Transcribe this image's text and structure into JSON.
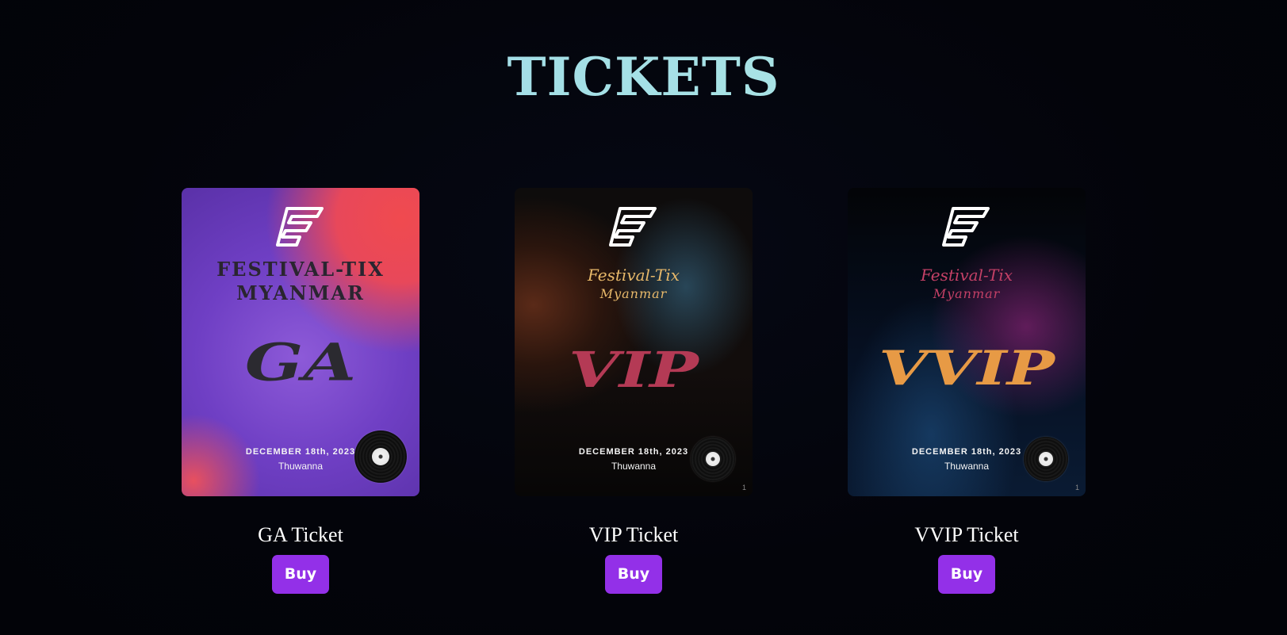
{
  "page": {
    "title": "TICKETS"
  },
  "tickets": [
    {
      "tier": "GA",
      "brand_line1": "FESTIVAL-TIX",
      "brand_line2": "MYANMAR",
      "date": "DECEMBER 18th, 2023",
      "venue": "Thuwanna",
      "page_number": "",
      "label": "GA Ticket",
      "button_label": "Buy"
    },
    {
      "tier": "VIP",
      "brand_line1": "Festival-Tix",
      "brand_line2": "Myanmar",
      "date": "DECEMBER 18th, 2023",
      "venue": "Thuwanna",
      "page_number": "1",
      "label": "VIP Ticket",
      "button_label": "Buy"
    },
    {
      "tier": "VVIP",
      "brand_line1": "Festival-Tix",
      "brand_line2": "Myanmar",
      "date": "DECEMBER 18th, 2023",
      "venue": "Thuwanna",
      "page_number": "1",
      "label": "VVIP Ticket",
      "button_label": "Buy"
    }
  ],
  "colors": {
    "background": "#03040a",
    "title_gradient_start": "#9fd8ea",
    "title_gradient_end": "#b5ece0",
    "button": "#9330e8",
    "label": "#ffffff"
  },
  "icons": {
    "brand_logo": "festival-tix-logo-icon",
    "record": "vinyl-record-icon"
  }
}
